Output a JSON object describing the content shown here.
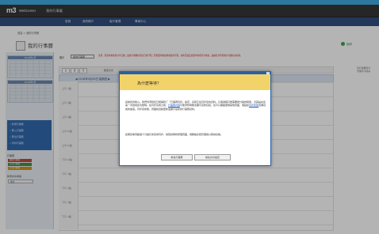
{
  "header": {
    "logo_mark": "m3",
    "logo_text": "WebCenter",
    "app_title": "我的行事曆"
  },
  "nav": {
    "items": [
      "首頁",
      "我的帳戶",
      "客戶管理",
      "專案中心"
    ]
  },
  "breadcrumb": "首頁 > 我的行事曆",
  "page": {
    "title": "我的行事曆",
    "help": "說明",
    "filter_label": "顯示",
    "filter_value": "我的行事曆",
    "filter_warning": "注意：若您尚未使用共享日曆，此處只會顯示您自己的行程；若需要查看其他成員的行程，請先至設定頁面中新增共享成員，並由對方同意後方可顯示其內容。",
    "right_note": [
      "從行事曆搜尋",
      "管理共享成員"
    ]
  },
  "toolbar": {
    "buttons": [
      "日",
      "週",
      "月"
    ],
    "label": "移至今日"
  },
  "day_header": "◀ 2018年4月26日 星期四 ▶",
  "times": [
    "上午 7點",
    "上午 8點",
    "上午 9點",
    "上午10點",
    "上午11點",
    "下午12點",
    "下午 1點",
    "下午 2點",
    "下午 3點",
    "下午 4點"
  ],
  "sidebar": {
    "cal1_head": "2018年4月",
    "cal2_head": "2018年5月",
    "blue_items": [
      "• 新增行事曆",
      "• 匯入行事曆",
      "• 匯出行事曆",
      "• 列印行事曆"
    ],
    "section_label": "行事曆",
    "swatches": [
      {
        "label": "我的行事曆",
        "color": "#c0392b"
      },
      {
        "label": "共享行事曆",
        "color": "#2e8b3a"
      },
      {
        "label": "公司行事曆",
        "color": "#d28a00"
      }
    ],
    "add_label": "新增共享成員",
    "search_label": "搜尋"
  },
  "dialog": {
    "title": "為什麼等待？",
    "close": "×",
    "body_pre": "感謝您的耐心。我們偵測到您已經開啟了「行事曆同步」設定，系統正在同步您的資料。這個過程可能需要幾分鐘的時間，尤其是在您第一次啟用此功能時。在同步完成之前，",
    "link1": "行事曆內容",
    "body_mid": "可能會暫時無法顯示完整資訊。您可以繼續瀏覽其他頁面，或點擊",
    "link2": "同步狀態",
    "body_post": "查看目前的進度。同步完成後，頁面將自動更新並顯示最新的行事曆資料。",
    "body2": "如果您等待超過十分鐘仍未完成同步，請嘗試重新整理頁面，或聯絡系統管理員以取得協助。",
    "btn_left": "前往行事曆",
    "btn_right": "前往共享設定"
  }
}
